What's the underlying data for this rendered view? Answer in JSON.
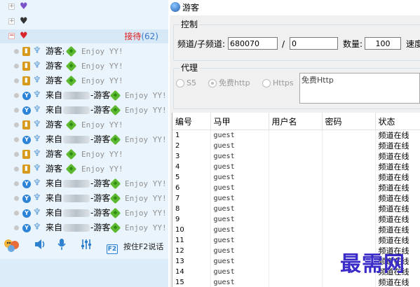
{
  "sidebar": {
    "group": {
      "label": "接待",
      "count": "(62)"
    },
    "users": [
      {
        "kind": "yy",
        "name": "游客",
        "cd": true,
        "msg": "Enjoy YY!"
      },
      {
        "kind": "yy",
        "name": "游客",
        "cd": false,
        "msg": "Enjoy YY!"
      },
      {
        "kind": "yy",
        "name": "游客",
        "cd": false,
        "msg": "Enjoy YY!"
      },
      {
        "kind": "pc",
        "pre": "来自",
        "name": "-游客",
        "msg": "Enjoy YY!"
      },
      {
        "kind": "pc",
        "pre": "来自",
        "name": "-游客",
        "msg": "Enjoy YY!"
      },
      {
        "kind": "yy",
        "name": "游客",
        "cd": false,
        "msg": "Enjoy YY!"
      },
      {
        "kind": "pc",
        "pre": "来自",
        "name": "-游客",
        "msg": "Enjoy YY!"
      },
      {
        "kind": "yy",
        "name": "游客",
        "cd": false,
        "msg": "Enjoy YY!"
      },
      {
        "kind": "yy",
        "name": "游客",
        "cd": false,
        "msg": "Enjoy YY!"
      },
      {
        "kind": "pc",
        "pre": "来自",
        "name": "-游客",
        "msg": "Enjoy YY!"
      },
      {
        "kind": "pc",
        "pre": "来自",
        "name": "-游客",
        "msg": "Enjoy YY!"
      },
      {
        "kind": "pc",
        "pre": "来自",
        "name": "-游客",
        "msg": "Enjoy YY!"
      },
      {
        "kind": "pc",
        "pre": "来自",
        "name": "-游客",
        "msg": "Enjoy YY!"
      }
    ],
    "toolbar": {
      "f2_key": "F2",
      "f2_label": "按住F2说话"
    }
  },
  "window": {
    "title": "游客",
    "control": {
      "legend": "控制",
      "channel_label": "频道/子频道:",
      "channel_value": "680070",
      "slash": "/",
      "subchannel_value": "0",
      "count_label": "数量:",
      "count_value": "100",
      "speed_label": "速度"
    },
    "proxy": {
      "legend": "代理",
      "options": [
        "S5",
        "免费http",
        "Https"
      ],
      "selected": "免费http",
      "text_value": "免费Http"
    },
    "table": {
      "headers": [
        "编号",
        "马甲",
        "用户名",
        "密码",
        "状态"
      ],
      "rows": [
        [
          "1",
          "guest",
          "",
          "",
          "频道在线"
        ],
        [
          "2",
          "guest",
          "",
          "",
          "频道在线"
        ],
        [
          "3",
          "guest",
          "",
          "",
          "频道在线"
        ],
        [
          "4",
          "guest",
          "",
          "",
          "频道在线"
        ],
        [
          "5",
          "guest",
          "",
          "",
          "频道在线"
        ],
        [
          "6",
          "guest",
          "",
          "",
          "频道在线"
        ],
        [
          "7",
          "guest",
          "",
          "",
          "频道在线"
        ],
        [
          "8",
          "guest",
          "",
          "",
          "频道在线"
        ],
        [
          "9",
          "guest",
          "",
          "",
          "频道在线"
        ],
        [
          "10",
          "guest",
          "",
          "",
          "频道在线"
        ],
        [
          "11",
          "guest",
          "",
          "",
          "频道在线"
        ],
        [
          "12",
          "guest",
          "",
          "",
          "频道在线"
        ],
        [
          "13",
          "guest",
          "",
          "",
          "频道在线"
        ],
        [
          "14",
          "guest",
          "",
          "",
          "频道在线"
        ],
        [
          "15",
          "guest",
          "",
          "",
          "频道在线"
        ]
      ]
    }
  },
  "watermark": "最需网"
}
